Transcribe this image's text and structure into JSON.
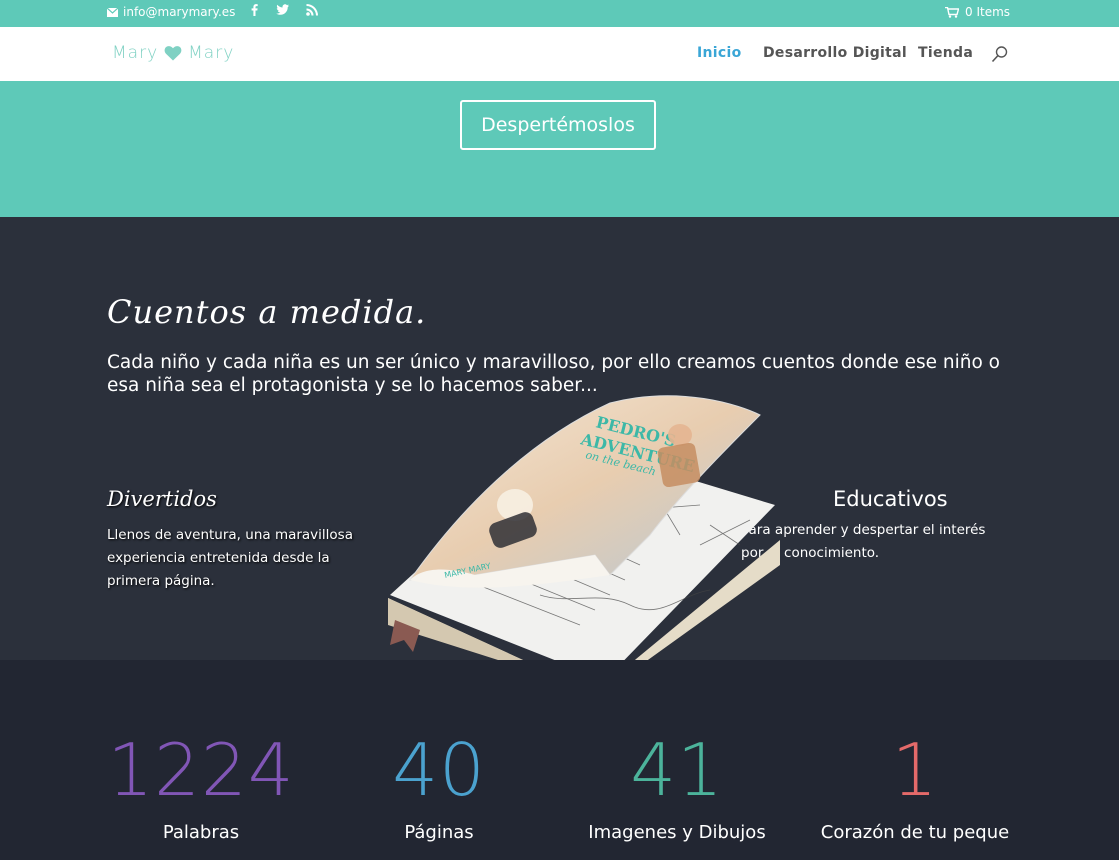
{
  "topbar": {
    "email": "info@marymary.es",
    "social_icons": [
      "facebook-icon",
      "twitter-icon",
      "rss-icon"
    ],
    "cart_label": "0 Items"
  },
  "header": {
    "logo_left": "Mary",
    "logo_right": "Mary",
    "nav": [
      {
        "label": "Inicio",
        "active": true
      },
      {
        "label": "Desarrollo Digital",
        "active": false
      },
      {
        "label": "Tienda",
        "active": false
      }
    ]
  },
  "hero": {
    "button_label": "Despertémoslos",
    "background": "#5ec9b8"
  },
  "stories": {
    "title": "Cuentos a medida.",
    "lead": "Cada niño y cada niña  es un ser único y maravilloso,  por ello creamos cuentos donde ese niño o esa niña sea el protagonista y se lo hacemos saber...",
    "features": [
      {
        "title": "Divertidos",
        "text": "Llenos de aventura, una maravillosa experiencia entretenida desde la primera página."
      },
      {
        "title": "Educativos",
        "text": "Para aprender y despertar el interés por el conocimiento."
      }
    ],
    "book": {
      "cover_title_1": "PEDRO'S",
      "cover_title_2": "ADVENTURE",
      "cover_subtitle": "on the beach",
      "cover_brand": "MARY MARY"
    }
  },
  "stats": [
    {
      "value": "1224",
      "label": "Palabras",
      "color": "#8156b6"
    },
    {
      "value": "40",
      "label": "Páginas",
      "color": "#4ba2cf"
    },
    {
      "value": "41",
      "label": "Imagenes y Dibujos",
      "color": "#4cb39b"
    },
    {
      "value": "1",
      "label": "Corazón de tu peque",
      "color": "#e46a6a"
    }
  ]
}
